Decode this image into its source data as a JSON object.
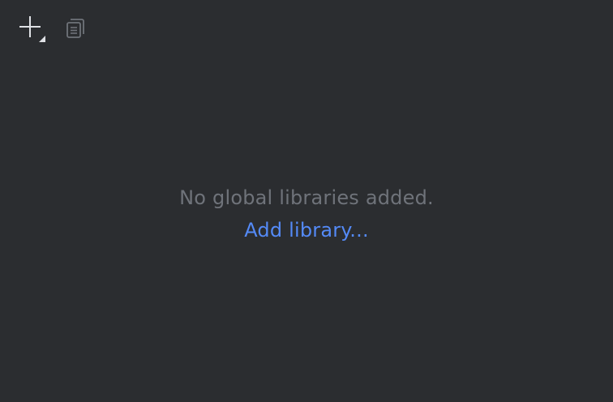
{
  "toolbar": {
    "add_button": {
      "icon": "plus-dropdown-icon"
    },
    "copy_button": {
      "icon": "copy-icon"
    }
  },
  "empty_state": {
    "message": "No global libraries added.",
    "link_label": "Add library..."
  },
  "colors": {
    "background": "#2b2d30",
    "muted_text": "#6f737a",
    "link": "#548af7",
    "icon": "#dfe1e5",
    "icon_disabled": "#6f737a"
  }
}
